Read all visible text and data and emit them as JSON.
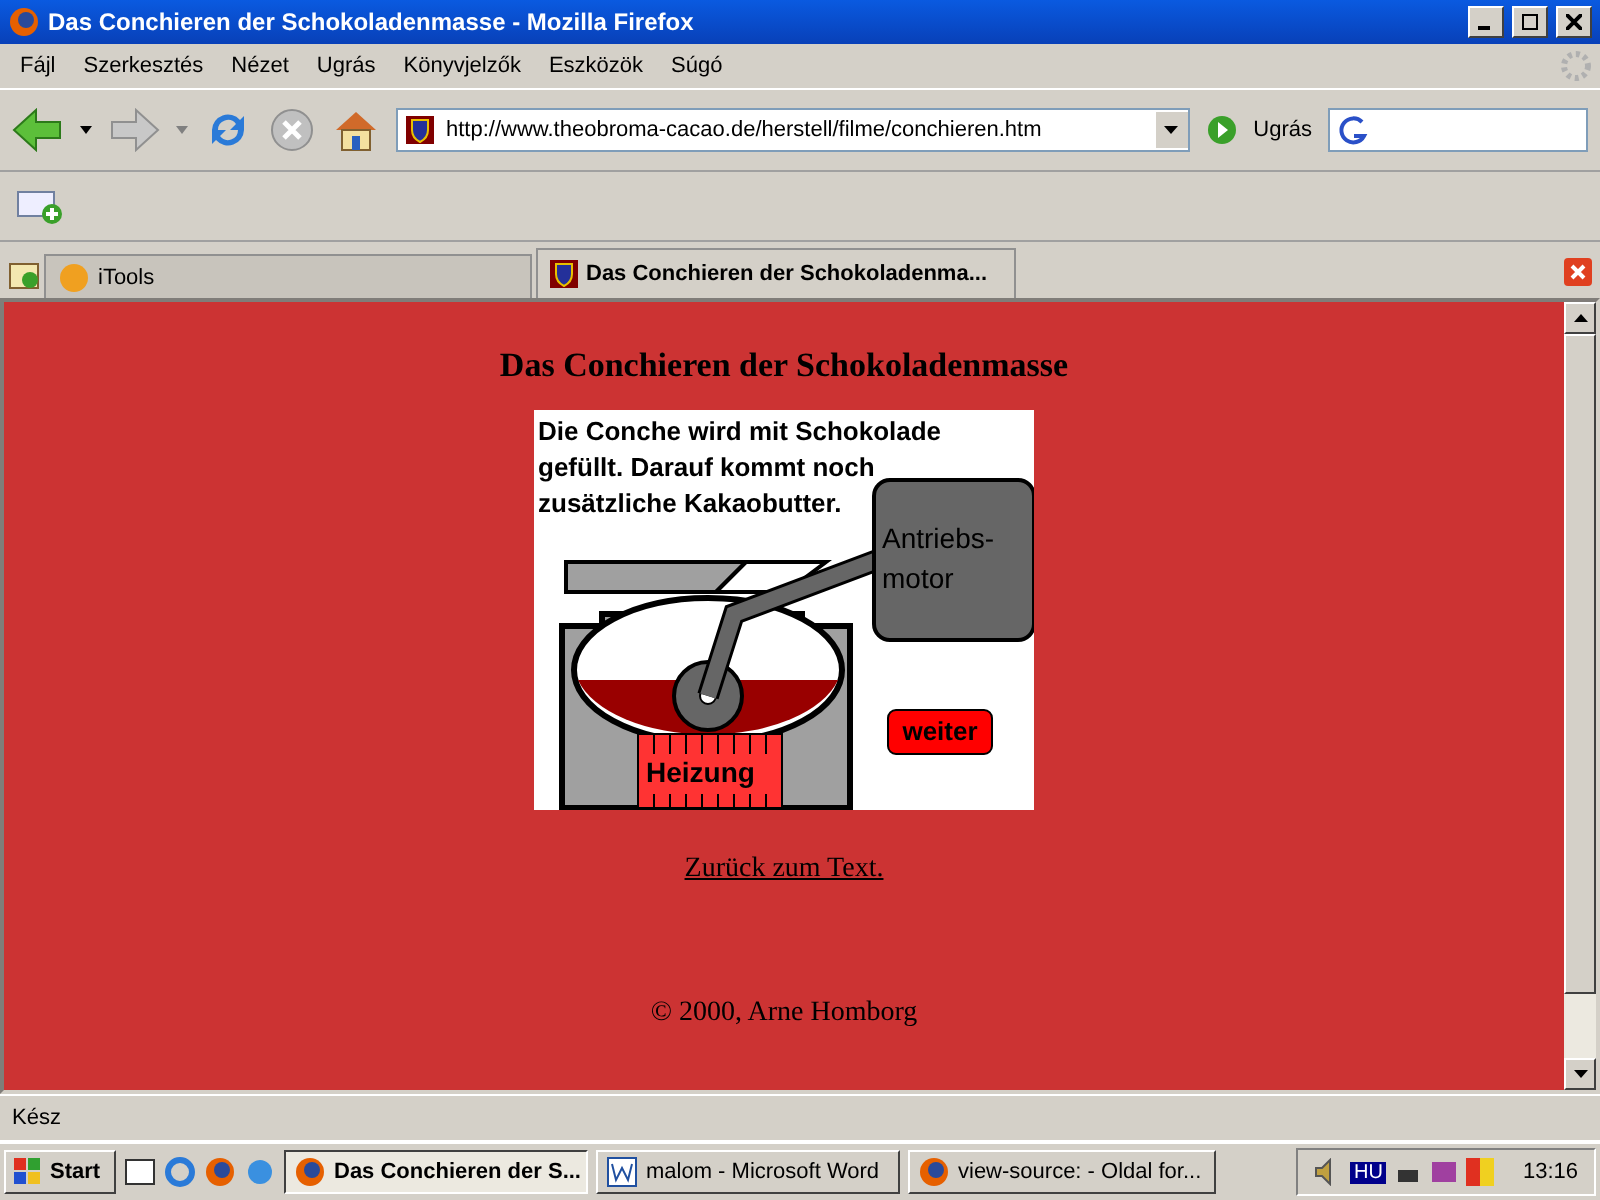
{
  "window": {
    "title": "Das Conchieren der Schokoladenmasse - Mozilla Firefox"
  },
  "menu": [
    "Fájl",
    "Szerkesztés",
    "Nézet",
    "Ugrás",
    "Könyvjelzők",
    "Eszközök",
    "Súgó"
  ],
  "address": {
    "url": "http://www.theobroma-cacao.de/herstell/filme/conchieren.htm",
    "go_label": "Ugrás"
  },
  "tabs": [
    {
      "label": "iTools",
      "selected": false
    },
    {
      "label": "Das Conchieren der Schokoladenma...",
      "selected": true
    }
  ],
  "page": {
    "heading": "Das Conchieren der Schokoladenmasse",
    "animation": {
      "caption": "Die Conche wird mit Schokolade gefüllt. Darauf kommt noch zusätzliche Kakaobutter.",
      "motor_label": [
        "Antriebs-",
        "motor"
      ],
      "heater_label": "Heizung",
      "next_button": "weiter"
    },
    "back_link": "Zurück zum Text.",
    "copyright": "© 2000, Arne Homborg"
  },
  "status_bar": {
    "text": "Kész"
  },
  "taskbar": {
    "start": "Start",
    "tasks": [
      {
        "label": "Das Conchieren der S...",
        "selected": true,
        "kind": "firefox"
      },
      {
        "label": "malom - Microsoft Word",
        "selected": false,
        "kind": "word"
      },
      {
        "label": "view-source: - Oldal for...",
        "selected": false,
        "kind": "firefox"
      }
    ],
    "tray": {
      "language": "HU",
      "time": "13:16"
    }
  }
}
